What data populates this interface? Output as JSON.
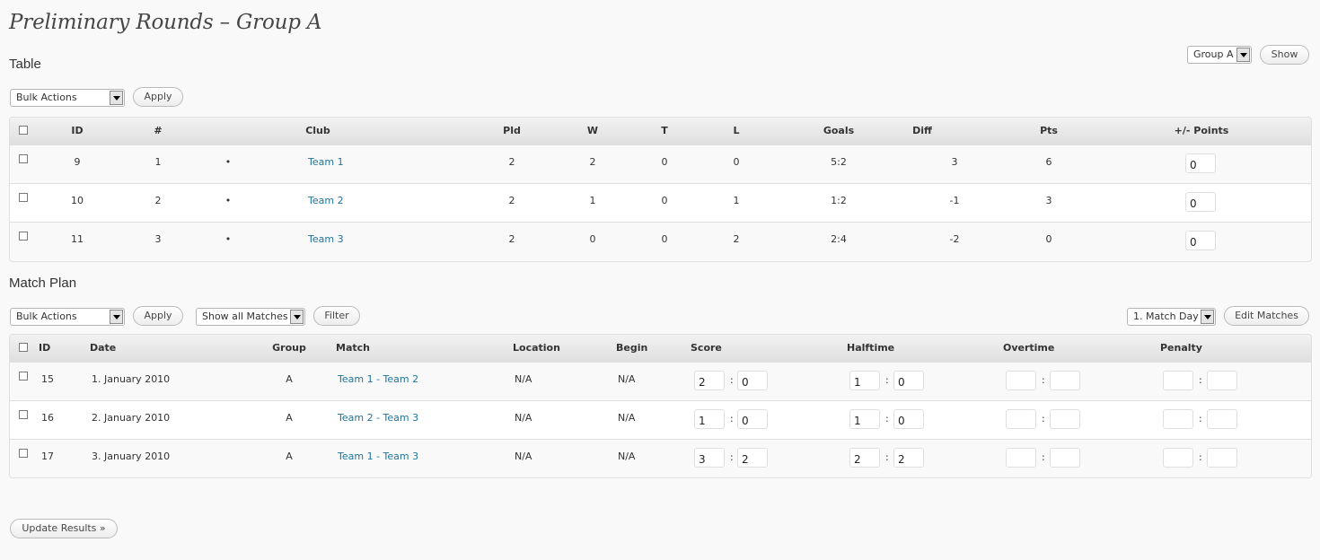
{
  "page": {
    "title": "Preliminary Rounds – Group A"
  },
  "group_select": {
    "value": "Group A",
    "show_label": "Show"
  },
  "table_section": {
    "title": "Table",
    "bulk_actions": "Bulk Actions",
    "apply_label": "Apply",
    "headers": [
      "ID",
      "#",
      "Club",
      "Pld",
      "W",
      "T",
      "L",
      "Goals",
      "Diff",
      "Pts",
      "+/- Points"
    ],
    "rows": [
      {
        "id": "9",
        "rank": "1",
        "bullet": "•",
        "club": "Team 1",
        "pld": "2",
        "w": "2",
        "t": "0",
        "l": "0",
        "goals": "5:2",
        "diff": "3",
        "pts": "6",
        "adj": "0"
      },
      {
        "id": "10",
        "rank": "2",
        "bullet": "•",
        "club": "Team 2",
        "pld": "2",
        "w": "1",
        "t": "0",
        "l": "1",
        "goals": "1:2",
        "diff": "-1",
        "pts": "3",
        "adj": "0"
      },
      {
        "id": "11",
        "rank": "3",
        "bullet": "•",
        "club": "Team 3",
        "pld": "2",
        "w": "0",
        "t": "0",
        "l": "2",
        "goals": "2:4",
        "diff": "-2",
        "pts": "0",
        "adj": "0"
      }
    ]
  },
  "match_section": {
    "title": "Match Plan",
    "bulk_actions": "Bulk Actions",
    "apply_label": "Apply",
    "show_matches": "Show all Matches",
    "filter_label": "Filter",
    "match_day": "1. Match Day",
    "edit_label": "Edit Matches",
    "headers": [
      "ID",
      "Date",
      "Group",
      "Match",
      "Location",
      "Begin",
      "Score",
      "Halftime",
      "Overtime",
      "Penalty"
    ],
    "separator": ":",
    "rows": [
      {
        "id": "15",
        "date": "1. January 2010",
        "group": "A",
        "match": "Team 1 - Team 2",
        "location": "N/A",
        "begin": "N/A",
        "score_home": "2",
        "score_away": "0",
        "ht_home": "1",
        "ht_away": "0",
        "ot_home": "",
        "ot_away": "",
        "pen_home": "",
        "pen_away": ""
      },
      {
        "id": "16",
        "date": "2. January 2010",
        "group": "A",
        "match": "Team 2 - Team 3",
        "location": "N/A",
        "begin": "N/A",
        "score_home": "1",
        "score_away": "0",
        "ht_home": "1",
        "ht_away": "0",
        "ot_home": "",
        "ot_away": "",
        "pen_home": "",
        "pen_away": ""
      },
      {
        "id": "17",
        "date": "3. January 2010",
        "group": "A",
        "match": "Team 1 - Team 3",
        "location": "N/A",
        "begin": "N/A",
        "score_home": "3",
        "score_away": "2",
        "ht_home": "2",
        "ht_away": "2",
        "ot_home": "",
        "ot_away": "",
        "pen_home": "",
        "pen_away": ""
      }
    ]
  },
  "update_button": "Update Results »"
}
